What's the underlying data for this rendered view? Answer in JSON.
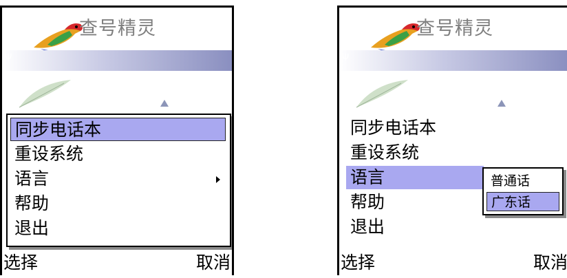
{
  "app": {
    "title": "查号精灵"
  },
  "menu": {
    "items": [
      {
        "label": "同步电话本"
      },
      {
        "label": "重设系统"
      },
      {
        "label": "语言",
        "has_submenu": true
      },
      {
        "label": "帮助"
      },
      {
        "label": "退出"
      }
    ]
  },
  "submenu": {
    "items": [
      {
        "label": "普通话"
      },
      {
        "label": "广东话"
      }
    ]
  },
  "softkeys": {
    "left": "选择",
    "right": "取消"
  },
  "colors": {
    "highlight": "#a9a8f0",
    "strip_dark": "#8a8fc0"
  }
}
